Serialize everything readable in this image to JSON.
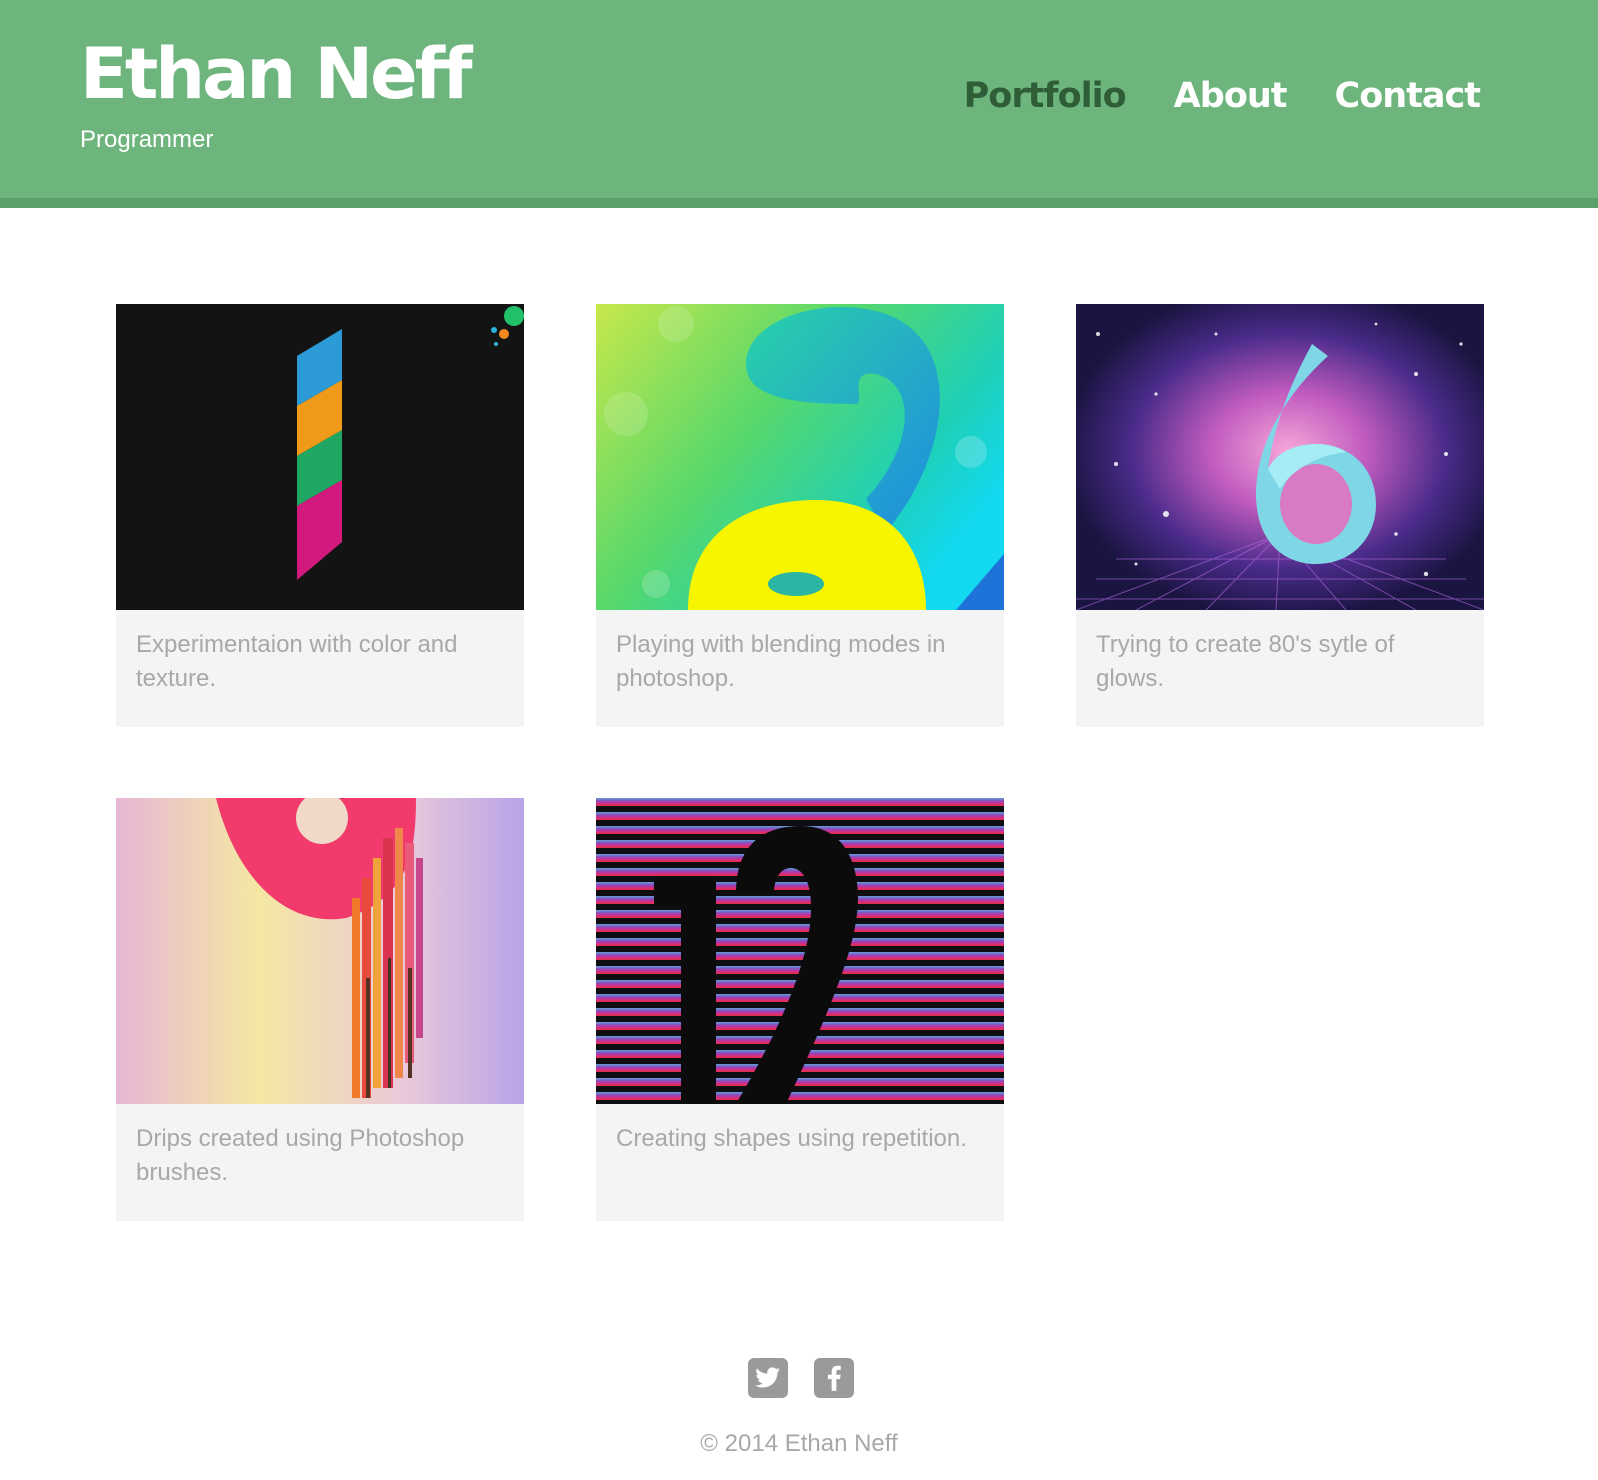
{
  "header": {
    "title": "Ethan Neff",
    "subtitle": "Programmer",
    "nav": [
      {
        "label": "Portfolio",
        "active": true
      },
      {
        "label": "About",
        "active": false
      },
      {
        "label": "Contact",
        "active": false
      }
    ]
  },
  "portfolio": {
    "items": [
      {
        "caption": "Experimentaion with color and texture.",
        "art": "number-1-stripes"
      },
      {
        "caption": "Playing with blending modes in photoshop.",
        "art": "number-2-and-8-gradient"
      },
      {
        "caption": "Trying to create 80's sytle of glows.",
        "art": "number-6-glow"
      },
      {
        "caption": "Drips created using Photoshop brushes.",
        "art": "number-9-drips"
      },
      {
        "caption": "Creating shapes using repetition.",
        "art": "number-12-stripes"
      }
    ]
  },
  "footer": {
    "social": [
      {
        "icon": "twitter-icon"
      },
      {
        "icon": "facebook-icon"
      }
    ],
    "copyright": "© 2014 Ethan Neff"
  },
  "colors": {
    "header_bg": "#6db57d",
    "header_border": "#5c9f6b",
    "nav_active": "#2f5d38",
    "caption_text": "#a8a8a8",
    "card_bg": "#f4f4f4"
  }
}
